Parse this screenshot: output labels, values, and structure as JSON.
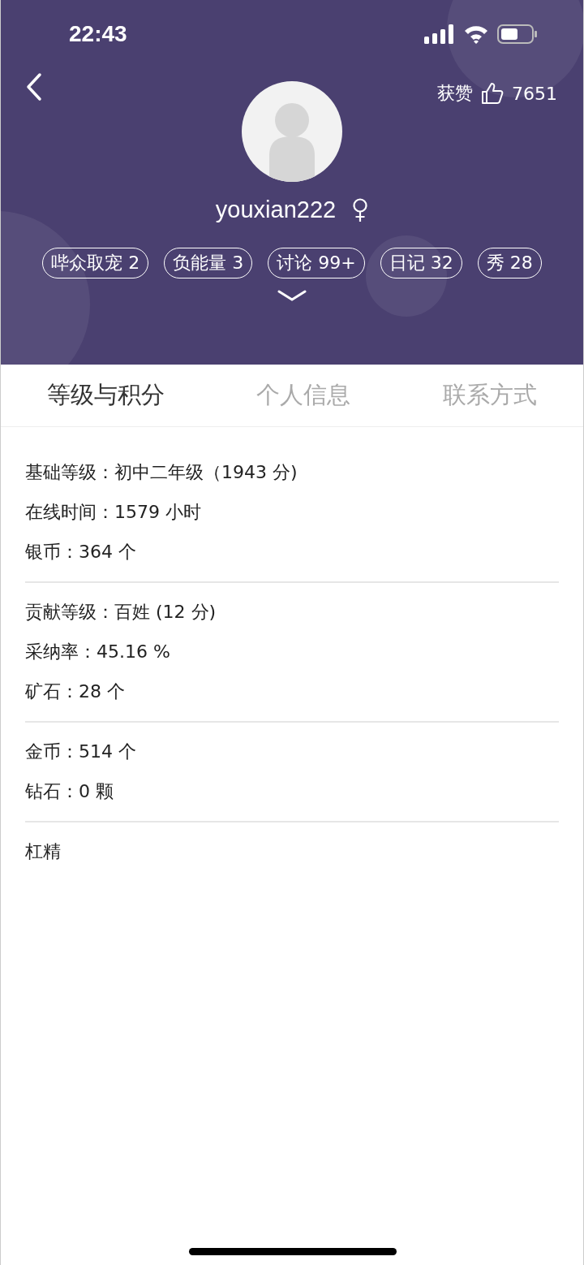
{
  "status_bar": {
    "time": "22:43"
  },
  "header": {
    "likes_label": "获赞",
    "likes_count": "7651",
    "username": "youxian222"
  },
  "stat_chips": [
    {
      "label": "哔众取宠 2"
    },
    {
      "label": "负能量 3"
    },
    {
      "label": "讨论 99+"
    },
    {
      "label": "日记 32"
    },
    {
      "label": "秀 28"
    }
  ],
  "tabs": [
    {
      "label": "等级与积分",
      "selected": true
    },
    {
      "label": "个人信息",
      "selected": false
    },
    {
      "label": "联系方式",
      "selected": false
    }
  ],
  "sections": [
    {
      "rows": [
        "基础等级：初中二年级（1943 分)",
        "在线时间：1579 小时",
        "银币：364 个"
      ]
    },
    {
      "rows": [
        "贡献等级：百姓 (12 分)",
        "采纳率：45.16 %",
        "矿石：28 个"
      ]
    },
    {
      "rows": [
        "金币：514 个",
        "钻石：0 颗"
      ]
    },
    {
      "rows": [
        "杠精"
      ]
    }
  ]
}
